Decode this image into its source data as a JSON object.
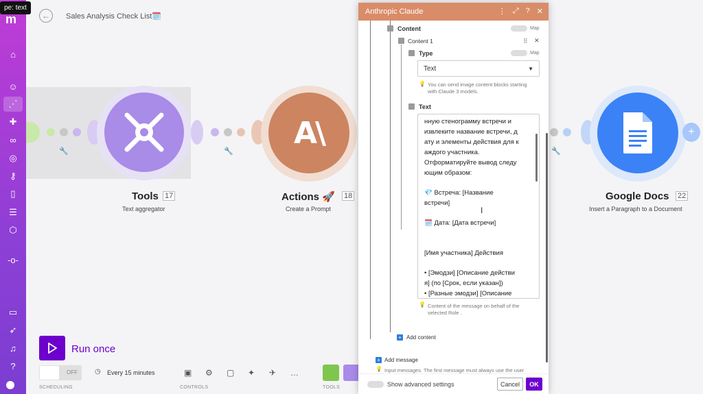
{
  "tooltip": "pe: text",
  "header": {
    "back_icon": "arrow-left-icon",
    "title": "Sales Analysis Check List🗓️"
  },
  "sidebar": {
    "icons": [
      "home-icon",
      "team-icon",
      "share-icon",
      "puzzle-icon",
      "link-icon",
      "globe-icon",
      "key-icon",
      "phone-icon",
      "database-icon",
      "cube-icon",
      "commit-icon",
      "book-icon",
      "rocket-icon",
      "bell-icon",
      "help-icon",
      "avatar"
    ]
  },
  "modules": [
    {
      "title": "Tools",
      "badge": "17",
      "subtitle": "Text aggregator",
      "color": "#a78be6"
    },
    {
      "title": "Actions 🚀",
      "badge": "18",
      "subtitle": "Create a Prompt",
      "color": "#d98c68"
    },
    {
      "title": "Google Docs",
      "badge": "22",
      "subtitle": "Insert a Paragraph to a Document",
      "color": "#3b82f6"
    }
  ],
  "modal": {
    "title": "Anthropic Claude",
    "content_label": "Content",
    "map_label": "Map",
    "content1_label": "Content 1",
    "type_label": "Type",
    "type_value": "Text",
    "type_hint_line1": "You can send image content blocks starting",
    "type_hint_line2": "with Claude 3 models.",
    "text_label": "Text",
    "text_lines": [
      "нную стенограмму встречи и",
      "извлеките название встречи, д",
      "ату и элементы действия для к",
      "аждого участника.",
      "Отформатируйте вывод следу",
      "ющим образом:",
      "",
      "💎 Встреча: [Название",
      "встречи]",
      "",
      "🗓️ Дата: [Дата встречи]",
      "",
      "",
      "[Имя участника] Действия",
      "",
      "• [Эмодзи] [Описание действи",
      "я] (по [Срок, если указан])",
      "• [Разные эмодзи] [Описание"
    ],
    "text_hint_line1": "Content of the message on behalf of the",
    "text_hint_line2": "selected Role .",
    "add_content": "Add content",
    "add_message": "Add message",
    "input_hint": "Input messages. The first message must always use the user",
    "show_advanced": "Show advanced settings",
    "cancel": "Cancel",
    "ok": "OK"
  },
  "bottom": {
    "run_once": "Run once",
    "toggle_state": "OFF",
    "schedule": "Every 15 minutes",
    "cap_scheduling": "SCHEDULING",
    "cap_controls": "CONTROLS",
    "cap_tools": "TOOLS"
  }
}
